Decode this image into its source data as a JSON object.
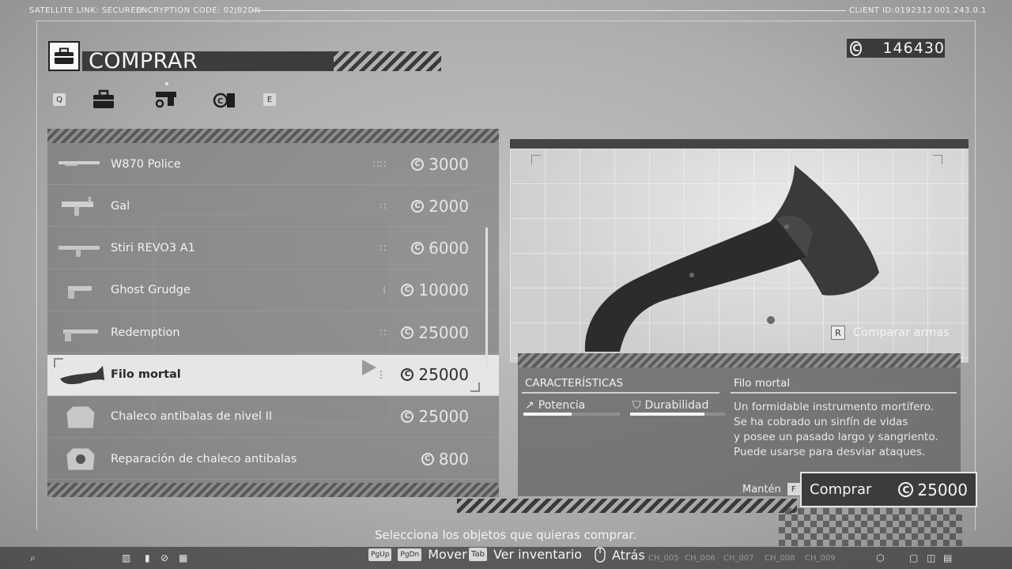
{
  "topbar": {
    "satellite": "SATELLITE LINK: SECURED",
    "encryption": "ENCRYPTION CODE: 02J82DN",
    "client_id": "CLIENT ID:0192312",
    "version": "001.243.0.1"
  },
  "header": {
    "title": "COMPRAR",
    "icon": "briefcase-icon"
  },
  "credits": {
    "value": "146430"
  },
  "tabs": {
    "prev_key": "Q",
    "next_key": "E",
    "items": [
      {
        "icon": "briefcase-icon"
      },
      {
        "icon": "pistol-icon"
      },
      {
        "icon": "credit-exchange-icon"
      }
    ]
  },
  "items": [
    {
      "name": "W870 Police",
      "price": "3000",
      "icon": "shotgun-icon",
      "dots": "∷∷"
    },
    {
      "name": "Gal",
      "price": "2000",
      "icon": "smg-icon",
      "dots": "∷"
    },
    {
      "name": "Stiri REVO3 A1",
      "price": "6000",
      "icon": "rifle-icon",
      "dots": "∷"
    },
    {
      "name": "Ghost Grudge",
      "price": "10000",
      "icon": "revolver-icon",
      "dots": "⁞"
    },
    {
      "name": "Redemption",
      "price": "25000",
      "icon": "revolver-long-icon",
      "dots": "∷"
    },
    {
      "name": "Filo mortal",
      "price": "25000",
      "icon": "axe-icon",
      "dots": "⋮",
      "selected": true
    },
    {
      "name": "Chaleco antibalas de nivel II",
      "price": "25000",
      "icon": "vest-icon",
      "dots": ""
    },
    {
      "name": "Reparación de chaleco antibalas",
      "price": "800",
      "icon": "vest-repair-icon",
      "dots": ""
    }
  ],
  "preview": {
    "compare_key": "R",
    "compare_label": "Comparar armas"
  },
  "details": {
    "section_title": "CARACTERÍSTICAS",
    "item_title": "Filo mortal",
    "attributes": [
      {
        "label": "Potencia",
        "icon": "power-icon",
        "level": 0.5
      },
      {
        "label": "Durabilidad",
        "icon": "shield-icon",
        "level": 0.78
      }
    ],
    "description": [
      "Un formidable instrumento mortífero.",
      "Se ha cobrado un sinfín de vidas",
      "y posee un pasado largo y sangriento.",
      "Puede usarse para desviar ataques."
    ]
  },
  "buy": {
    "hold_label": "Mantén",
    "hold_key": "F",
    "label": "Comprar",
    "price": "25000"
  },
  "bottom": {
    "prompt": "Selecciona los objetos que quieras comprar.",
    "hints": [
      {
        "keys": [
          "PgUp",
          "PgDn"
        ],
        "label": "Mover"
      },
      {
        "keys": [
          "Tab"
        ],
        "label": "Ver inventario"
      },
      {
        "keys": [
          "mouse-icon"
        ],
        "label": "Atrás"
      }
    ],
    "channels": [
      "CH_005",
      "CH_006",
      "CH_007",
      "CH_008",
      "CH_009"
    ]
  },
  "colors": {
    "panel_dark": "#3c3c3c",
    "selected_row": "#e6e6e6",
    "text_light": "#f2f2f2"
  }
}
